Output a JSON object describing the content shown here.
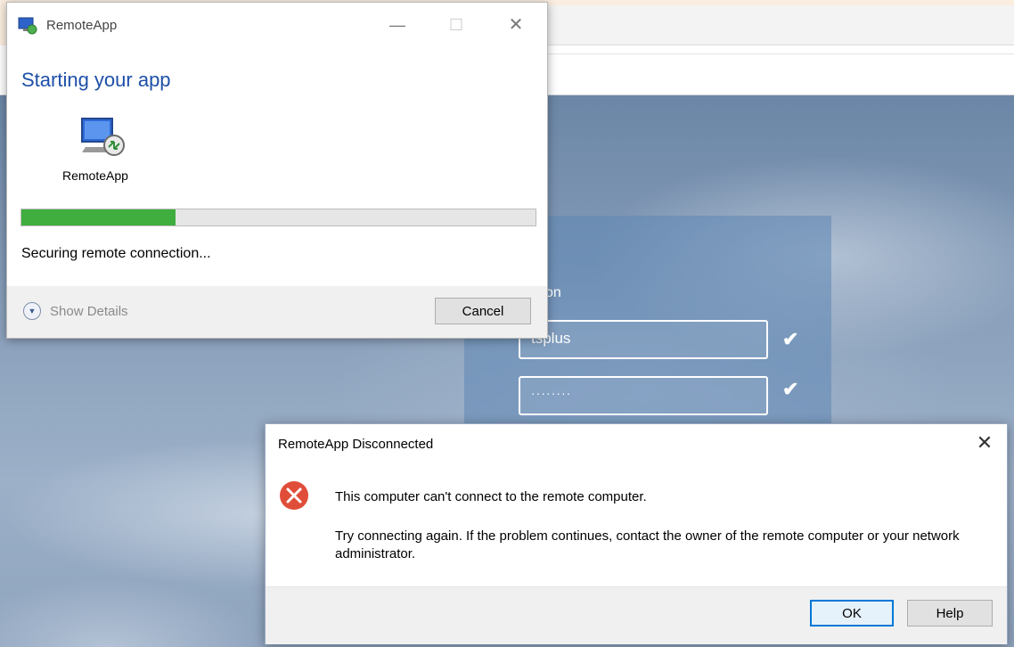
{
  "background": {
    "login_heading_partial": "on",
    "username_value": "tsplus",
    "password_value": "········"
  },
  "starting_dialog": {
    "title": "RemoteApp",
    "heading": "Starting your app",
    "app_label": "RemoteApp",
    "progress_percent": 30,
    "status": "Securing remote connection...",
    "show_details_label": "Show Details",
    "cancel_label": "Cancel",
    "minimize_glyph": "—",
    "maximize_glyph": "☐",
    "close_glyph": "✕"
  },
  "disconnected_dialog": {
    "title": "RemoteApp Disconnected",
    "close_glyph": "✕",
    "message": "This computer can't connect to the remote computer.",
    "detail": "Try connecting again. If the problem continues, contact the owner of the remote computer or your network administrator.",
    "ok_label": "OK",
    "help_label": "Help"
  },
  "colors": {
    "progress_green": "#3fae3f",
    "heading_blue": "#1e50a8",
    "error_red": "#e04e39"
  }
}
